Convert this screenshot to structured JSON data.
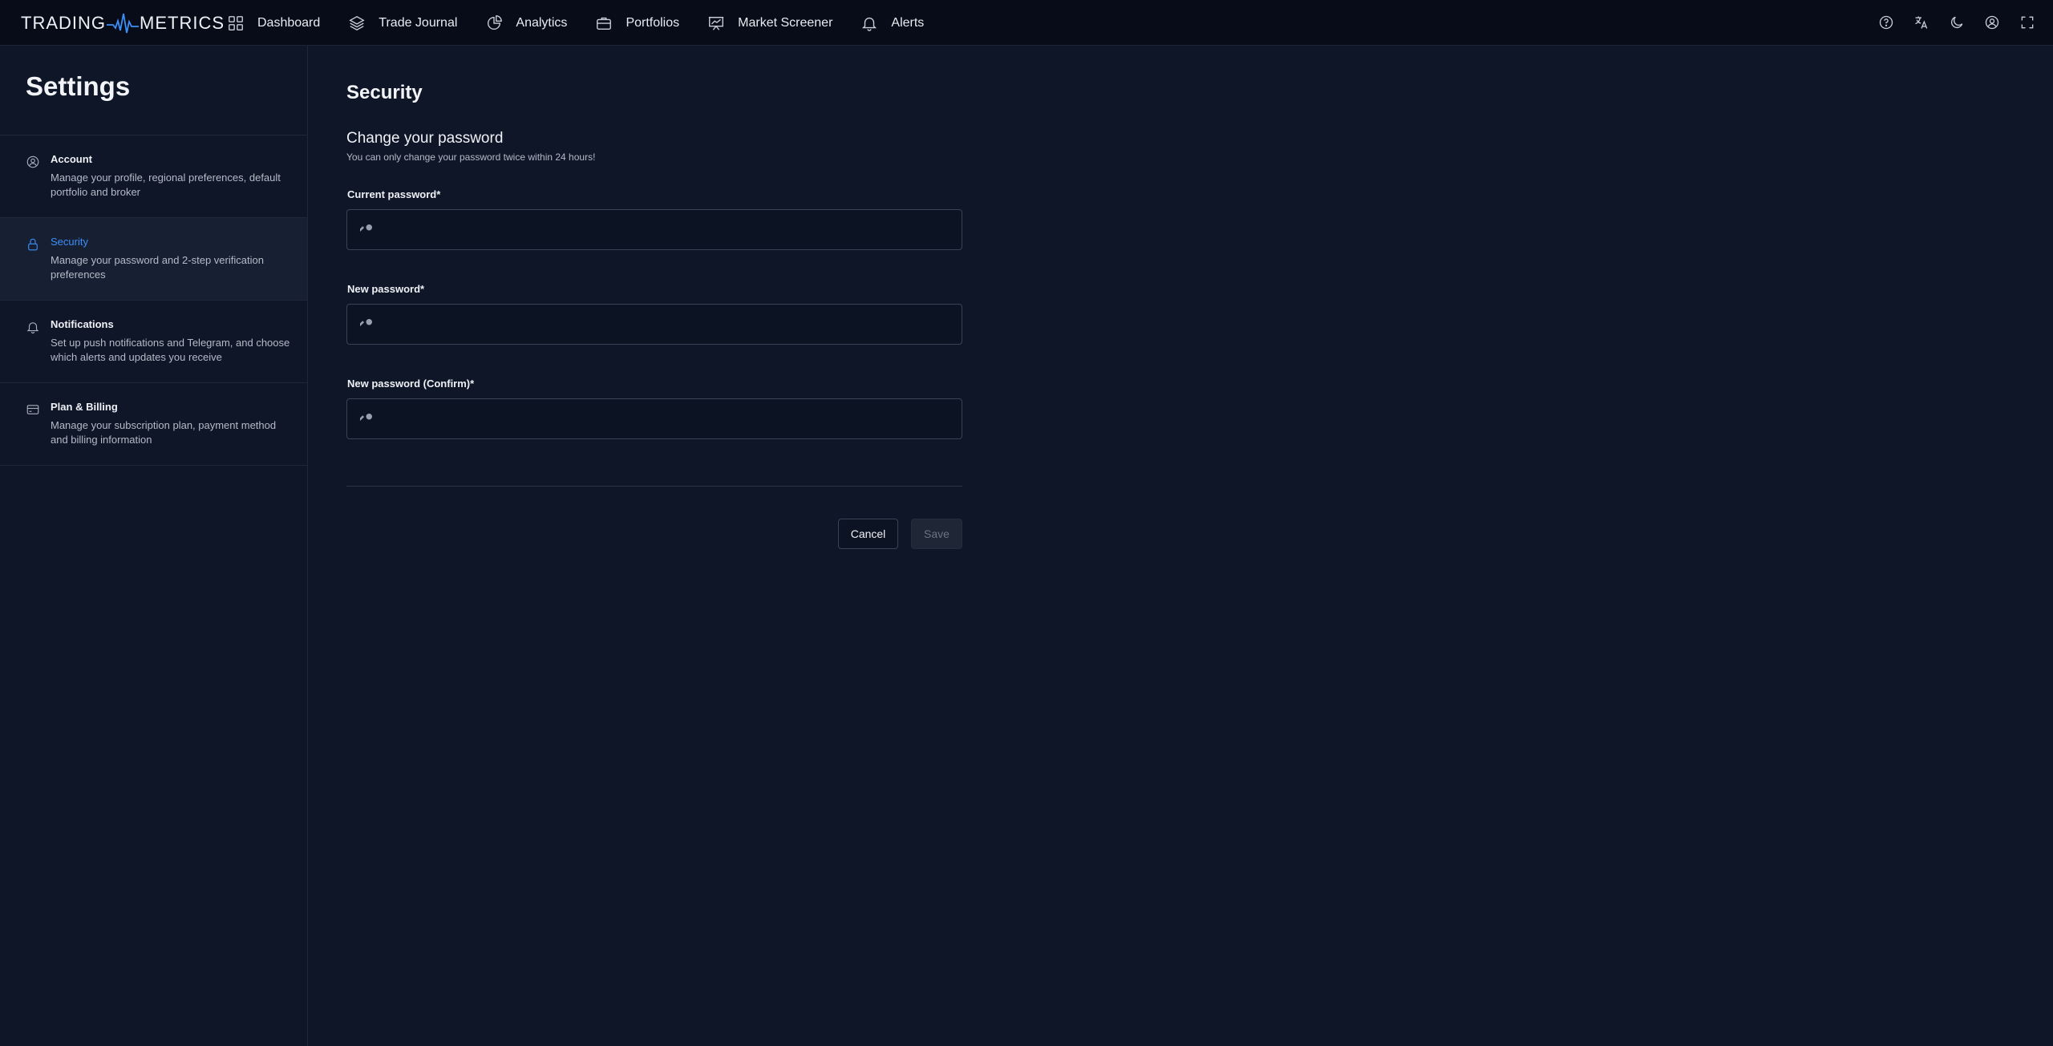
{
  "app": {
    "logo_left": "TRADING",
    "logo_right": "METRICS"
  },
  "nav": {
    "items": [
      {
        "label": "Dashboard",
        "icon": "grid-icon"
      },
      {
        "label": "Trade Journal",
        "icon": "layers-icon"
      },
      {
        "label": "Analytics",
        "icon": "pie-chart-icon"
      },
      {
        "label": "Portfolios",
        "icon": "briefcase-icon"
      },
      {
        "label": "Market Screener",
        "icon": "presentation-chart-icon"
      },
      {
        "label": "Alerts",
        "icon": "bell-icon"
      }
    ],
    "right_icons": [
      "help-icon",
      "translate-icon",
      "moon-icon",
      "user-icon",
      "fullscreen-icon"
    ]
  },
  "sidebar": {
    "title": "Settings",
    "items": [
      {
        "title": "Account",
        "desc": "Manage your profile, regional preferences, default portfolio and broker",
        "icon": "user-circle-icon",
        "active": false
      },
      {
        "title": "Security",
        "desc": "Manage your password and 2-step verification preferences",
        "icon": "lock-icon",
        "active": true
      },
      {
        "title": "Notifications",
        "desc": "Set up push notifications and Telegram, and choose which alerts and updates you receive",
        "icon": "bell-icon",
        "active": false
      },
      {
        "title": "Plan & Billing",
        "desc": "Manage your subscription plan, payment method and billing information",
        "icon": "credit-card-icon",
        "active": false
      }
    ]
  },
  "main": {
    "title": "Security",
    "section_title": "Change your password",
    "section_subtitle": "You can only change your password twice within 24 hours!",
    "fields": [
      {
        "label": "Current password",
        "required_mark": "*",
        "value": "",
        "placeholder": ""
      },
      {
        "label": "New password",
        "required_mark": "*",
        "value": "",
        "placeholder": ""
      },
      {
        "label": "New password (Confirm)",
        "required_mark": "*",
        "value": "",
        "placeholder": ""
      }
    ],
    "cancel_label": "Cancel",
    "save_label": "Save"
  },
  "colors": {
    "background": "#0f1627",
    "topbar": "#070c18",
    "accent": "#3d8ef7",
    "border": "#3a4356"
  }
}
